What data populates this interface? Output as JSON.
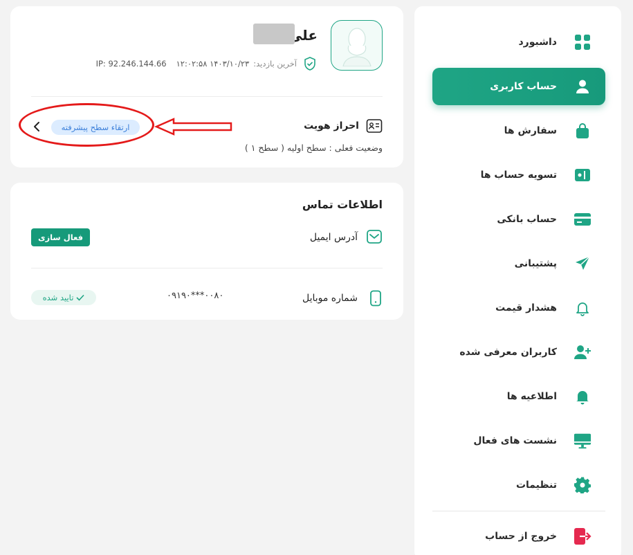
{
  "sidebar": {
    "items": [
      {
        "label": "داشبورد",
        "icon": "dashboard-icon",
        "active": false
      },
      {
        "label": "حساب کاربری",
        "icon": "user-icon",
        "active": true
      },
      {
        "label": "سفارش ها",
        "icon": "shopping-bag-icon",
        "active": false
      },
      {
        "label": "تسویه حساب ها",
        "icon": "wallet-icon",
        "active": false
      },
      {
        "label": "حساب بانکی",
        "icon": "credit-card-icon",
        "active": false
      },
      {
        "label": "پشتیبانی",
        "icon": "send-icon",
        "active": false
      },
      {
        "label": "هشدار قیمت",
        "icon": "bell-outline-icon",
        "active": false
      },
      {
        "label": "کاربران معرفی شده",
        "icon": "user-plus-icon",
        "active": false
      },
      {
        "label": "اطلاعیه ها",
        "icon": "bell-icon",
        "active": false
      },
      {
        "label": "نشست های فعال",
        "icon": "monitor-icon",
        "active": false
      },
      {
        "label": "تنظیمات",
        "icon": "gear-icon",
        "active": false
      }
    ],
    "logout_label": "خروج از حساب",
    "accent_color": "#1fa585",
    "logout_color": "#e5294f"
  },
  "profile": {
    "name": "علی",
    "last_visit_label": "آخرین بازدید:",
    "last_visit_value": "۱۴۰۳/۱۰/۲۳  ۱۲:۰۲:۵۸",
    "ip": "IP: 92.246.144.66",
    "kyc_label": "احراز هویت",
    "kyc_status": "وضعیت فعلی : سطح اولیه ( سطح ۱ )",
    "upgrade_label": "ارتقاء سطح پیشرفته"
  },
  "contact": {
    "title": "اطلاعات تماس",
    "email_label": "آدرس ایمیل",
    "activate_label": "فعال سازی",
    "mobile_label": "شماره موبایل",
    "mobile_value": "۰۹۱۹۰***۰۰۸۰",
    "verified_label": "تایید شده"
  }
}
